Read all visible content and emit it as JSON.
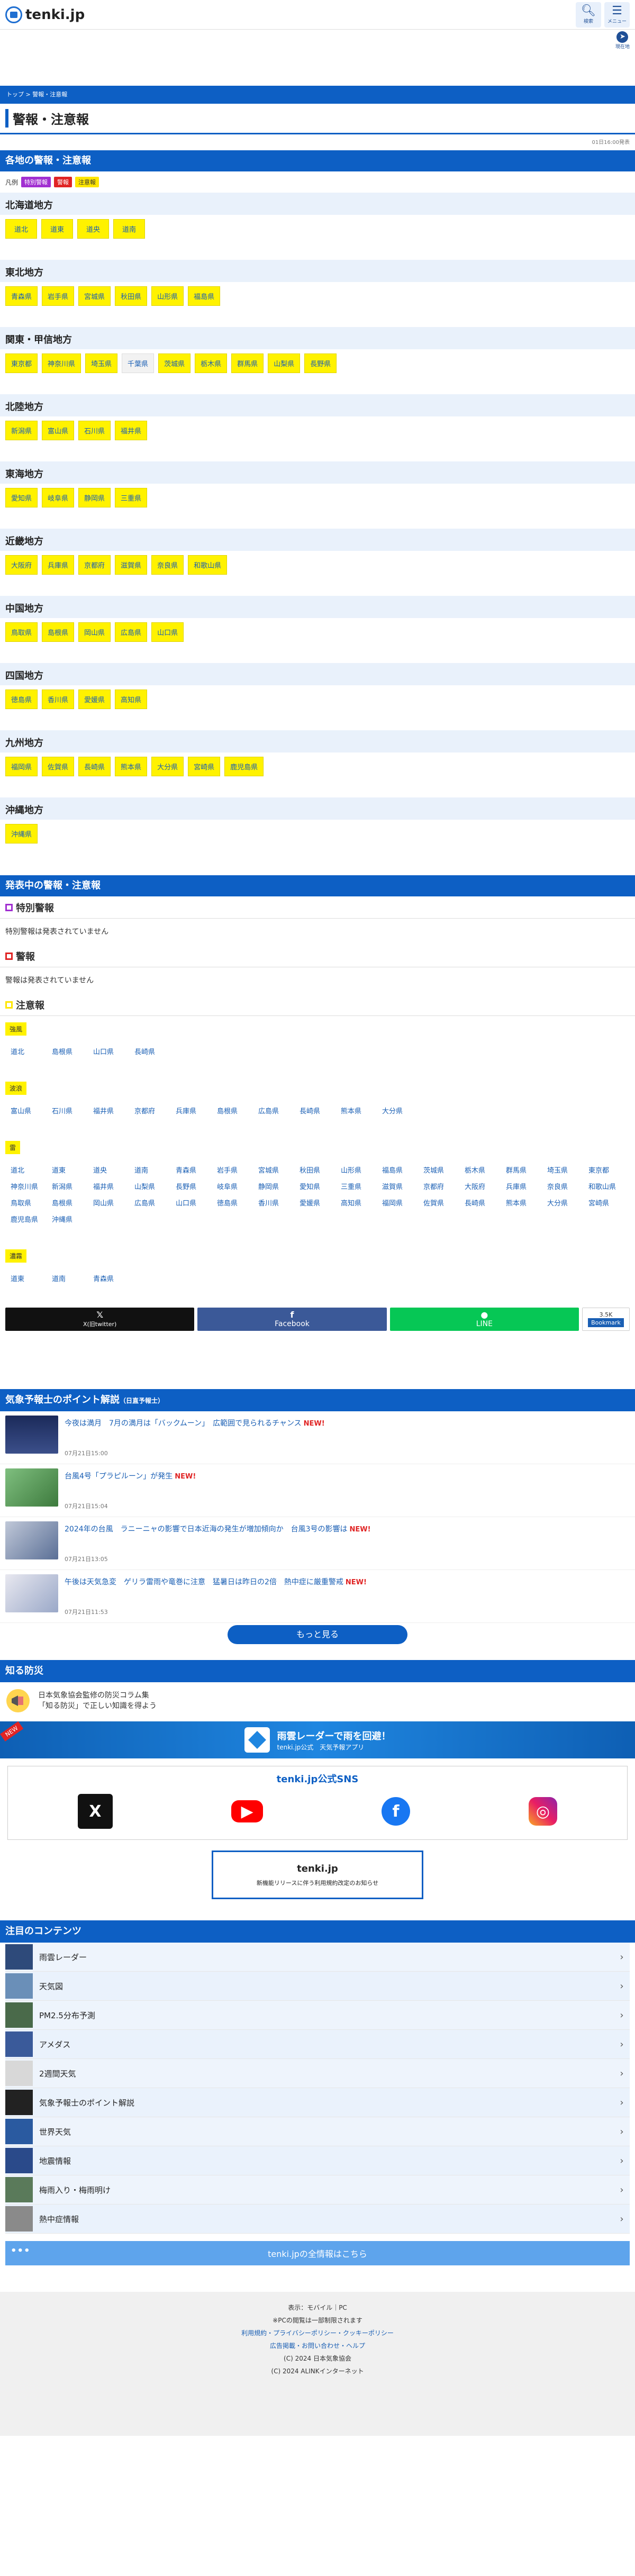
{
  "header": {
    "logo_text": "tenki.jp",
    "search_label": "検索",
    "menu_label": "メニュー",
    "here_label": "現在地"
  },
  "breadcrumb": {
    "home": "トップ",
    "sep": " > ",
    "current": "警報・注意報"
  },
  "page_title": "警報・注意報",
  "updated": "01日16:00発表",
  "regional": {
    "heading": "各地の警報・注意報",
    "legend_label": "凡例",
    "legend": [
      "特別警報",
      "警報",
      "注意報"
    ],
    "regions": [
      {
        "name": "北海道地方",
        "prefs": [
          {
            "n": "道北",
            "s": "a"
          },
          {
            "n": "道東",
            "s": "a"
          },
          {
            "n": "道央",
            "s": "a"
          },
          {
            "n": "道南",
            "s": "a"
          }
        ]
      },
      {
        "name": "東北地方",
        "prefs": [
          {
            "n": "青森県",
            "s": "a"
          },
          {
            "n": "岩手県",
            "s": "a"
          },
          {
            "n": "宮城県",
            "s": "a"
          },
          {
            "n": "秋田県",
            "s": "a"
          },
          {
            "n": "山形県",
            "s": "a"
          },
          {
            "n": "福島県",
            "s": "a"
          }
        ]
      },
      {
        "name": "関東・甲信地方",
        "prefs": [
          {
            "n": "東京都",
            "s": "a"
          },
          {
            "n": "神奈川県",
            "s": "a"
          },
          {
            "n": "埼玉県",
            "s": "a"
          },
          {
            "n": "千葉県",
            "s": "n"
          },
          {
            "n": "茨城県",
            "s": "a"
          },
          {
            "n": "栃木県",
            "s": "a"
          },
          {
            "n": "群馬県",
            "s": "a"
          },
          {
            "n": "山梨県",
            "s": "a"
          },
          {
            "n": "長野県",
            "s": "a"
          }
        ]
      },
      {
        "name": "北陸地方",
        "prefs": [
          {
            "n": "新潟県",
            "s": "a"
          },
          {
            "n": "富山県",
            "s": "a"
          },
          {
            "n": "石川県",
            "s": "a"
          },
          {
            "n": "福井県",
            "s": "a"
          }
        ]
      },
      {
        "name": "東海地方",
        "prefs": [
          {
            "n": "愛知県",
            "s": "a"
          },
          {
            "n": "岐阜県",
            "s": "a"
          },
          {
            "n": "静岡県",
            "s": "a"
          },
          {
            "n": "三重県",
            "s": "a"
          }
        ]
      },
      {
        "name": "近畿地方",
        "prefs": [
          {
            "n": "大阪府",
            "s": "a"
          },
          {
            "n": "兵庫県",
            "s": "a"
          },
          {
            "n": "京都府",
            "s": "a"
          },
          {
            "n": "滋賀県",
            "s": "a"
          },
          {
            "n": "奈良県",
            "s": "a"
          },
          {
            "n": "和歌山県",
            "s": "a"
          }
        ]
      },
      {
        "name": "中国地方",
        "prefs": [
          {
            "n": "鳥取県",
            "s": "a"
          },
          {
            "n": "島根県",
            "s": "a"
          },
          {
            "n": "岡山県",
            "s": "a"
          },
          {
            "n": "広島県",
            "s": "a"
          },
          {
            "n": "山口県",
            "s": "a"
          }
        ]
      },
      {
        "name": "四国地方",
        "prefs": [
          {
            "n": "徳島県",
            "s": "a"
          },
          {
            "n": "香川県",
            "s": "a"
          },
          {
            "n": "愛媛県",
            "s": "a"
          },
          {
            "n": "高知県",
            "s": "a"
          }
        ]
      },
      {
        "name": "九州地方",
        "prefs": [
          {
            "n": "福岡県",
            "s": "a"
          },
          {
            "n": "佐賀県",
            "s": "a"
          },
          {
            "n": "長崎県",
            "s": "a"
          },
          {
            "n": "熊本県",
            "s": "a"
          },
          {
            "n": "大分県",
            "s": "a"
          },
          {
            "n": "宮崎県",
            "s": "a"
          },
          {
            "n": "鹿児島県",
            "s": "a"
          }
        ]
      },
      {
        "name": "沖縄地方",
        "prefs": [
          {
            "n": "沖縄県",
            "s": "a"
          }
        ]
      }
    ]
  },
  "announced": {
    "heading": "発表中の警報・注意報",
    "special_title": "特別警報",
    "special_text": "特別警報は発表されていません",
    "warning_title": "警報",
    "warning_text": "警報は発表されていません",
    "advisory_title": "注意報",
    "groups": [
      {
        "kind": "強風",
        "areas": [
          "道北",
          "島根県",
          "山口県",
          "長崎県"
        ]
      },
      {
        "kind": "波浪",
        "areas": [
          "富山県",
          "石川県",
          "福井県",
          "京都府",
          "兵庫県",
          "島根県",
          "広島県",
          "長崎県",
          "熊本県",
          "大分県"
        ]
      },
      {
        "kind": "雷",
        "areas": [
          "道北",
          "道東",
          "道央",
          "道南",
          "青森県",
          "岩手県",
          "宮城県",
          "秋田県",
          "山形県",
          "福島県",
          "茨城県",
          "栃木県",
          "群馬県",
          "埼玉県",
          "東京都",
          "神奈川県",
          "新潟県",
          "福井県",
          "山梨県",
          "長野県",
          "岐阜県",
          "静岡県",
          "愛知県",
          "三重県",
          "滋賀県",
          "京都府",
          "大阪府",
          "兵庫県",
          "奈良県",
          "和歌山県",
          "鳥取県",
          "島根県",
          "岡山県",
          "広島県",
          "山口県",
          "徳島県",
          "香川県",
          "愛媛県",
          "高知県",
          "福岡県",
          "佐賀県",
          "長崎県",
          "熊本県",
          "大分県",
          "宮崎県",
          "鹿児島県",
          "沖縄県"
        ]
      },
      {
        "kind": "濃霧",
        "areas": [
          "道東",
          "道南",
          "青森県"
        ]
      }
    ]
  },
  "share": {
    "x_label": "X(旧twitter)",
    "fb_label": "Facebook",
    "line_label": "LINE",
    "b_count": "3.5K",
    "b_label": "Bookmark"
  },
  "forecaster": {
    "heading": "気象予報士のポイント解説",
    "heading_sub": "（日直予報士）",
    "items": [
      {
        "title": "今夜は満月　7月の満月は「バックムーン」　広範囲で見られるチャンス",
        "new": "NEW!",
        "date": "07月21日15:00"
      },
      {
        "title": "台風4号「プラピルーン」が発生",
        "new": "NEW!",
        "date": "07月21日15:04"
      },
      {
        "title": "2024年の台風　ラニーニャの影響で日本近海の発生が増加傾向か　台風3号の影響は",
        "new": "NEW!",
        "date": "07月21日13:05"
      },
      {
        "title": "午後は天気急変　ゲリラ雷雨や竜巻に注意　猛暑日は昨日の2倍　熱中症に厳重警戒",
        "new": "NEW!",
        "date": "07月21日11:53"
      }
    ],
    "more_label": "もっと見る"
  },
  "bousai": {
    "heading": "知る防災",
    "line1": "日本気象協会監修の防災コラム集",
    "line2": "「知る防災」で正しい知識を得よう"
  },
  "banner": {
    "new_tag": "NEW",
    "title": "雨雲レーダーで雨を回避！",
    "sub": "tenki.jp公式　天気予報アプリ"
  },
  "sns": {
    "title": "tenki.jp公式SNS",
    "x": "X",
    "yt": "▶",
    "fb": "f",
    "ig": "◎"
  },
  "notice": {
    "logo": "tenki.jp",
    "text": "新機能リリースに伴う利用規約改定のお知らせ"
  },
  "contents": {
    "heading": "注目のコンテンツ",
    "items": [
      "雨雲レーダー",
      "天気図",
      "PM2.5分布予測",
      "アメダス",
      "2週間天気",
      "気象予報士のポイント解説",
      "世界天気",
      "地震情報",
      "梅雨入り・梅雨明け",
      "熱中症情報"
    ],
    "all_dots": "•••",
    "all_label": "tenki.jpの全情報はこちら"
  },
  "footer": {
    "display_label": "表示：モバイル｜PC",
    "pc_note": "※PCの閲覧は一部制限されます",
    "links1": "利用規約・プライバシーポリシー・クッキーポリシー",
    "links2": "広告掲載・お問い合わせ・ヘルプ",
    "copy1": "(C) 2024 日本気象協会",
    "copy2": "(C) 2024 ALINKインターネット"
  }
}
